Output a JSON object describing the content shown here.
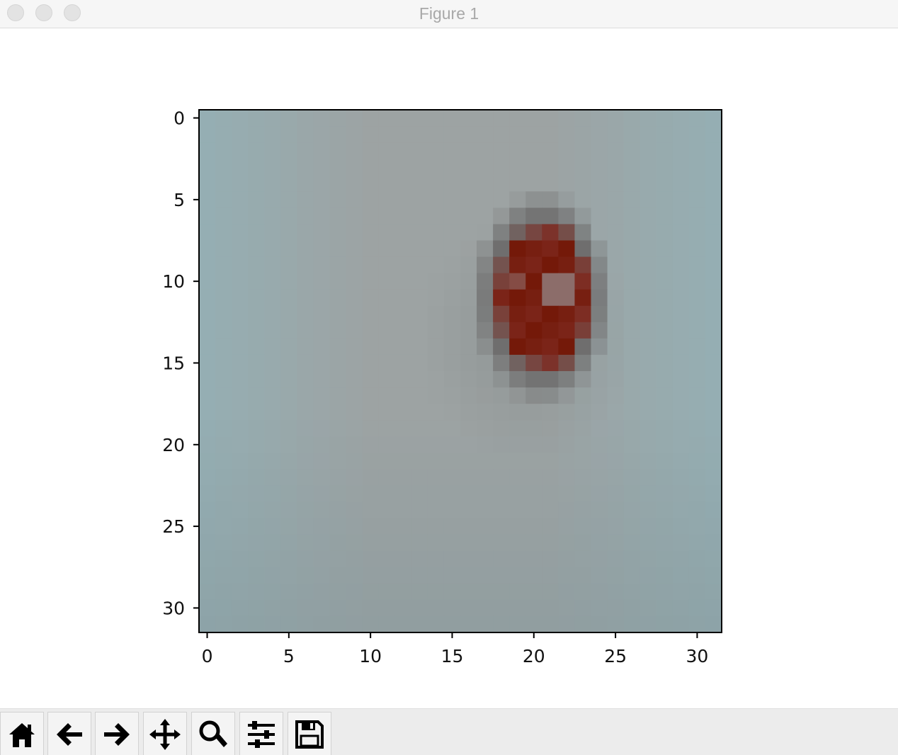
{
  "window": {
    "title": "Figure 1"
  },
  "toolbar": {
    "buttons": [
      {
        "icon": "home-icon",
        "tooltip": "Reset original view"
      },
      {
        "icon": "back-arrow-icon",
        "tooltip": "Back to previous view"
      },
      {
        "icon": "forward-arrow-icon",
        "tooltip": "Forward to next view"
      },
      {
        "icon": "pan-move-icon",
        "tooltip": "Pan axes"
      },
      {
        "icon": "zoom-magnifier-icon",
        "tooltip": "Zoom to rectangle"
      },
      {
        "icon": "configure-subplots-icon",
        "tooltip": "Configure subplots"
      },
      {
        "icon": "save-floppy-icon",
        "tooltip": "Save the figure"
      }
    ]
  },
  "chart_data": {
    "type": "heatmap",
    "title": "",
    "xlabel": "",
    "ylabel": "",
    "image_size": [
      32,
      32
    ],
    "xlim": [
      -0.5,
      31.5
    ],
    "ylim": [
      31.5,
      -0.5
    ],
    "x_ticks": [
      0,
      5,
      10,
      15,
      20,
      25,
      30
    ],
    "y_ticks": [
      0,
      5,
      10,
      15,
      20,
      25,
      30
    ],
    "x_tick_labels": [
      "0",
      "5",
      "10",
      "15",
      "20",
      "25",
      "30"
    ],
    "y_tick_labels": [
      "0",
      "5",
      "10",
      "15",
      "20",
      "25",
      "30"
    ],
    "background_color": "#8fa0a5",
    "object": {
      "description_color": "#7a1a10",
      "center": [
        20.5,
        11
      ],
      "radius_x": 3,
      "radius_y": 4.6
    },
    "colors": {
      "edge_light": "#95aeb3",
      "mid_light": "#9da3a3",
      "bottom_dark": "#86999d",
      "blob_dark_red": "#741909",
      "blob_mid_red": "#7e2a20",
      "halo_gray": "#6e6d6d",
      "highlight_gray": "#8c6d6a"
    },
    "grid": false
  }
}
